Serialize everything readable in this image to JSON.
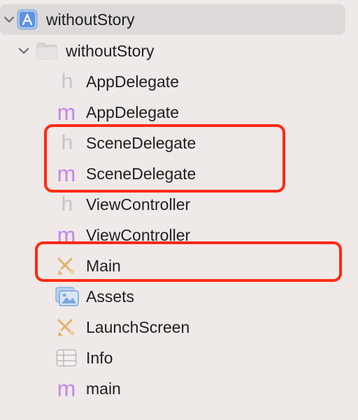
{
  "navigator": {
    "project": {
      "label": "withoutStory",
      "icon": "xcode-project-icon",
      "expanded": true
    },
    "group": {
      "label": "withoutStory",
      "icon": "folder-icon",
      "expanded": true
    },
    "files": [
      {
        "label": "AppDelegate",
        "icon": "header-file-icon",
        "glyph": "h"
      },
      {
        "label": "AppDelegate",
        "icon": "objc-implementation-file-icon",
        "glyph": "m"
      },
      {
        "label": "SceneDelegate",
        "icon": "header-file-icon",
        "glyph": "h"
      },
      {
        "label": "SceneDelegate",
        "icon": "objc-implementation-file-icon",
        "glyph": "m"
      },
      {
        "label": "ViewController",
        "icon": "header-file-icon",
        "glyph": "h"
      },
      {
        "label": "ViewController",
        "icon": "objc-implementation-file-icon",
        "glyph": "m"
      },
      {
        "label": "Main",
        "icon": "storyboard-icon"
      },
      {
        "label": "Assets",
        "icon": "asset-catalog-icon"
      },
      {
        "label": "LaunchScreen",
        "icon": "storyboard-icon"
      },
      {
        "label": "Info",
        "icon": "plist-icon"
      },
      {
        "label": "main",
        "icon": "objc-implementation-file-icon",
        "glyph": "m"
      }
    ]
  },
  "colors": {
    "background": "#efe9e8",
    "selected_row": "#dddad9",
    "header_glyph": "#c9c3c5",
    "implementation_glyph": "#c487e8",
    "storyboard_icon": "#e8b25a",
    "annotation_box": "#ff2a12"
  }
}
